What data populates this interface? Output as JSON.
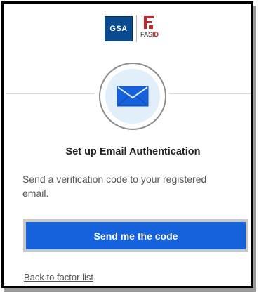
{
  "header": {
    "gsa_logo_text": "GSA",
    "fas_logo_prefix": "FAS",
    "fas_logo_suffix": "ID"
  },
  "factor": {
    "icon": "envelope-icon",
    "icon_color": "#1662dd",
    "title": "Set up Email Authentication",
    "description": "Send a verification code to your registered email."
  },
  "actions": {
    "send_code_label": "Send me the code",
    "back_link_label": "Back to factor list"
  },
  "colors": {
    "primary_button": "#1662dd",
    "icon_background": "#e1effb",
    "gsa_blue": "#0a4a8f",
    "fas_red": "#c1272d"
  }
}
